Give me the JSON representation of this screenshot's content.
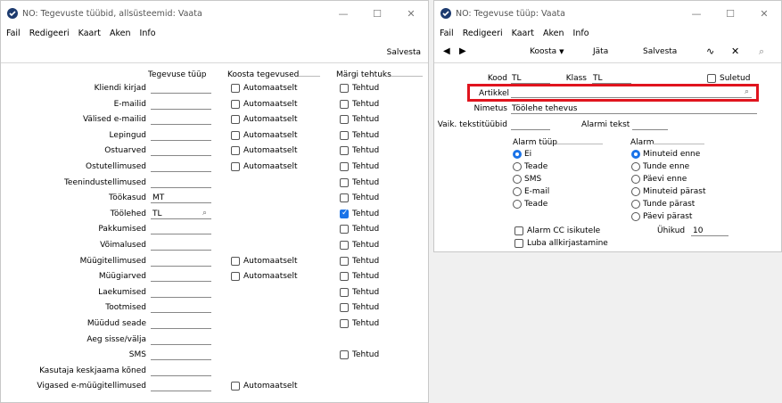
{
  "left": {
    "title": "NO: Tegevuste tüübid, allsüsteemid: Vaata",
    "menu": [
      "Fail",
      "Redigeeri",
      "Kaart",
      "Aken",
      "Info"
    ],
    "save": "Salvesta",
    "col_headers": [
      "Tegevuse tüüp",
      "Koosta tegevused",
      "Märgi tehtuks"
    ],
    "auto_label": "Automaatselt",
    "done_label": "Tehtud",
    "rows": [
      {
        "label": "Kliendi kirjad",
        "value": "",
        "auto": true,
        "done": true,
        "checked": false
      },
      {
        "label": "E-mailid",
        "value": "",
        "auto": true,
        "done": true,
        "checked": false
      },
      {
        "label": "Välised e-mailid",
        "value": "",
        "auto": true,
        "done": true,
        "checked": false
      },
      {
        "label": "Lepingud",
        "value": "",
        "auto": true,
        "done": true,
        "checked": false
      },
      {
        "label": "Ostuarved",
        "value": "",
        "auto": true,
        "done": true,
        "checked": false
      },
      {
        "label": "Ostutellimused",
        "value": "",
        "auto": true,
        "done": true,
        "checked": false
      },
      {
        "label": "Teenindustellimused",
        "value": "",
        "auto": false,
        "done": true,
        "checked": false
      },
      {
        "label": "Töökasud",
        "value": "MT",
        "auto": false,
        "done": true,
        "checked": false
      },
      {
        "label": "Töölehed",
        "value": "TL",
        "auto": false,
        "done": true,
        "checked": true
      },
      {
        "label": "Pakkumised",
        "value": "",
        "auto": false,
        "done": true,
        "checked": false
      },
      {
        "label": "Võimalused",
        "value": "",
        "auto": false,
        "done": true,
        "checked": false
      },
      {
        "label": "Müügitellimused",
        "value": "",
        "auto": true,
        "done": true,
        "checked": false
      },
      {
        "label": "Müügiarved",
        "value": "",
        "auto": true,
        "done": true,
        "checked": false
      },
      {
        "label": "Laekumised",
        "value": "",
        "auto": false,
        "done": true,
        "checked": false
      },
      {
        "label": "Tootmised",
        "value": "",
        "auto": false,
        "done": true,
        "checked": false
      },
      {
        "label": "Müüdud seade",
        "value": "",
        "auto": false,
        "done": true,
        "checked": false
      },
      {
        "label": "Aeg sisse/välja",
        "value": "",
        "auto": false,
        "done": false,
        "checked": false
      },
      {
        "label": "SMS",
        "value": "",
        "auto": false,
        "done": true,
        "checked": false
      },
      {
        "label": "Kasutaja keskjaama kõned",
        "value": "",
        "auto": false,
        "done": false,
        "checked": false
      },
      {
        "label": "Vigased e-müügitellimused",
        "value": "",
        "auto": true,
        "done": false,
        "checked": false
      }
    ]
  },
  "right": {
    "title": "NO: Tegevuse tüüp: Vaata",
    "menu": [
      "Fail",
      "Redigeeri",
      "Kaart",
      "Aken",
      "Info"
    ],
    "toolbar": {
      "create": "Koosta",
      "discard": "Jäta",
      "save": "Salvesta"
    },
    "kood_label": "Kood",
    "kood_value": "TL",
    "klass_label": "Klass",
    "klass_value": "TL",
    "suletud_label": "Suletud",
    "artikkel_label": "Artikkel",
    "nimetus_label": "Nimetus",
    "nimetus_value": "Töölehe tehevus",
    "vaik_label": "Vaik. tekstitüübid",
    "alarmi_tekst_label": "Alarmi tekst",
    "alarm_type_header": "Alarm tüüp",
    "alarm_type_options": [
      "Ei",
      "Teade",
      "SMS",
      "E-mail",
      "Teade"
    ],
    "alarm_header": "Alarm",
    "alarm_options": [
      "Minuteid enne",
      "Tunde enne",
      "Päevi enne",
      "Minuteid pärast",
      "Tunde pärast",
      "Päevi pärast"
    ],
    "alarm_cc_label": "Alarm CC isikutele",
    "luba_label": "Luba allkirjastamine",
    "uhikud_label": "Ühikud",
    "uhikud_value": "10",
    "highlight_color": "#e0141e"
  }
}
